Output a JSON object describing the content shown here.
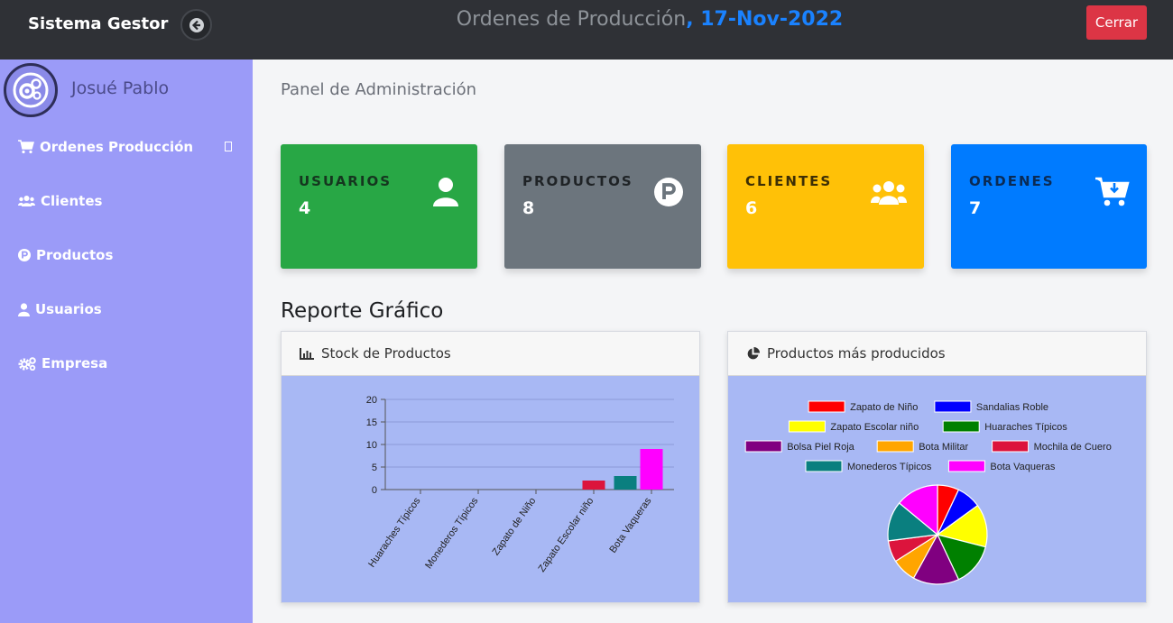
{
  "header": {
    "brand": "Sistema Gestor",
    "title_prefix": "Ordenes de Producción",
    "title_date": ", 17-Nov-2022",
    "close_label": "Cerrar"
  },
  "sidebar": {
    "user_name": "Josué Pablo",
    "items": [
      {
        "label": "Ordenes Producción",
        "icon": "cart-icon"
      },
      {
        "label": "Clientes",
        "icon": "users-icon"
      },
      {
        "label": "Productos",
        "icon": "product-p-icon"
      },
      {
        "label": "Usuarios",
        "icon": "user-icon"
      },
      {
        "label": "Empresa",
        "icon": "cogs-icon"
      }
    ]
  },
  "main": {
    "panel_title": "Panel de Administración",
    "cards": [
      {
        "label": "USUARIOS",
        "value": "4",
        "color": "#28a745",
        "icon": "user-icon"
      },
      {
        "label": "PRODUCTOS",
        "value": "8",
        "color": "#6c757d",
        "icon": "product-p-icon"
      },
      {
        "label": "CLIENTES",
        "value": "6",
        "color": "#ffc107",
        "icon": "users-icon"
      },
      {
        "label": "ORDENES",
        "value": "7",
        "color": "#007bff",
        "icon": "cart-download-icon"
      }
    ],
    "report_title": "Reporte Gráfico"
  },
  "chart_data": [
    {
      "type": "bar",
      "title": "Stock de Productos",
      "categories": [
        "Huaraches Típicos",
        "Monederos Típicos",
        "Zapato de Niño",
        "Zapato Escolar niño",
        "Bota Vaqueras"
      ],
      "values": [
        0,
        0,
        0,
        2,
        9
      ],
      "extra_bars": [
        {
          "value": 3,
          "color": "#0a7f7f"
        }
      ],
      "colors": [
        "#00aa00",
        "#0a7f7f",
        "#ff0000",
        "#dc143c",
        "#ff00ff"
      ],
      "ylim": [
        0,
        20
      ],
      "yticks": [
        0,
        5,
        10,
        15,
        20
      ],
      "grid": true
    },
    {
      "type": "pie",
      "title": "Productos más producidos",
      "labels": [
        "Zapato de Niño",
        "Sandalias Roble",
        "Zapato Escolar niño",
        "Huaraches Típicos",
        "Bolsa Piel Roja",
        "Bota Militar",
        "Mochila de Cuero",
        "Monederos Típicos",
        "Bota Vaqueras"
      ],
      "values": [
        7,
        8,
        14,
        14,
        15,
        8,
        7,
        13,
        14
      ],
      "colors": [
        "#ff0000",
        "#0000ff",
        "#ffff00",
        "#008000",
        "#800080",
        "#ffa500",
        "#dc143c",
        "#0a7f7f",
        "#ff00ff"
      ],
      "legend": "top"
    }
  ]
}
